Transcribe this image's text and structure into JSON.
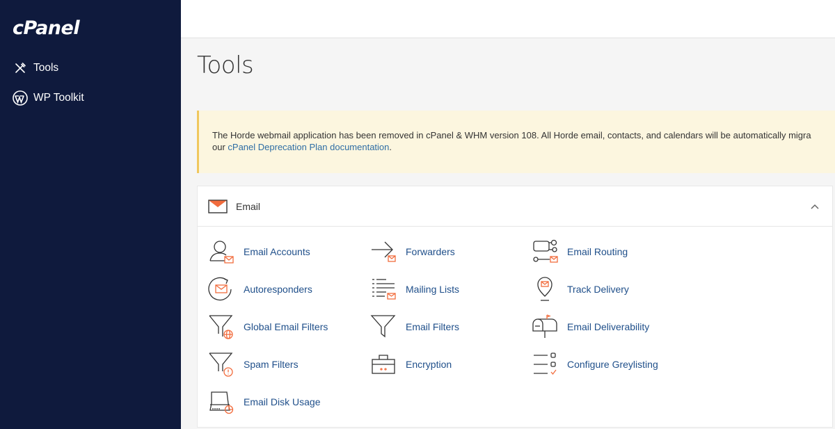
{
  "sidebar": {
    "logo": "cPanel",
    "items": [
      {
        "label": "Tools",
        "icon": "tools-icon"
      },
      {
        "label": "WP Toolkit",
        "icon": "wordpress-icon"
      }
    ]
  },
  "page": {
    "title": "Tools"
  },
  "notice": {
    "text_before": "The Horde webmail application has been removed in cPanel & WHM version 108. All Horde email, contacts, and calendars will be automatically migra",
    "text_line2_prefix": "our ",
    "link_text": "cPanel Deprecation Plan documentation",
    "text_after": "."
  },
  "email_section": {
    "title": "Email",
    "tools": [
      {
        "label": "Email Accounts",
        "icon": "email-accounts-icon"
      },
      {
        "label": "Forwarders",
        "icon": "forwarders-icon"
      },
      {
        "label": "Email Routing",
        "icon": "email-routing-icon"
      },
      {
        "label": "Autoresponders",
        "icon": "autoresponders-icon"
      },
      {
        "label": "Mailing Lists",
        "icon": "mailing-lists-icon"
      },
      {
        "label": "Track Delivery",
        "icon": "track-delivery-icon"
      },
      {
        "label": "Global Email Filters",
        "icon": "global-email-filters-icon"
      },
      {
        "label": "Email Filters",
        "icon": "email-filters-icon"
      },
      {
        "label": "Email Deliverability",
        "icon": "email-deliverability-icon"
      },
      {
        "label": "Spam Filters",
        "icon": "spam-filters-icon"
      },
      {
        "label": "Encryption",
        "icon": "encryption-icon"
      },
      {
        "label": "Configure Greylisting",
        "icon": "greylisting-icon"
      },
      {
        "label": "Email Disk Usage",
        "icon": "email-disk-usage-icon"
      }
    ]
  },
  "colors": {
    "sidebar_bg": "#0f1a3d",
    "accent_orange": "#f26c3d",
    "link_blue": "#1f4f8a",
    "notice_bg": "#fcf6df",
    "notice_border": "#f0c75e"
  }
}
